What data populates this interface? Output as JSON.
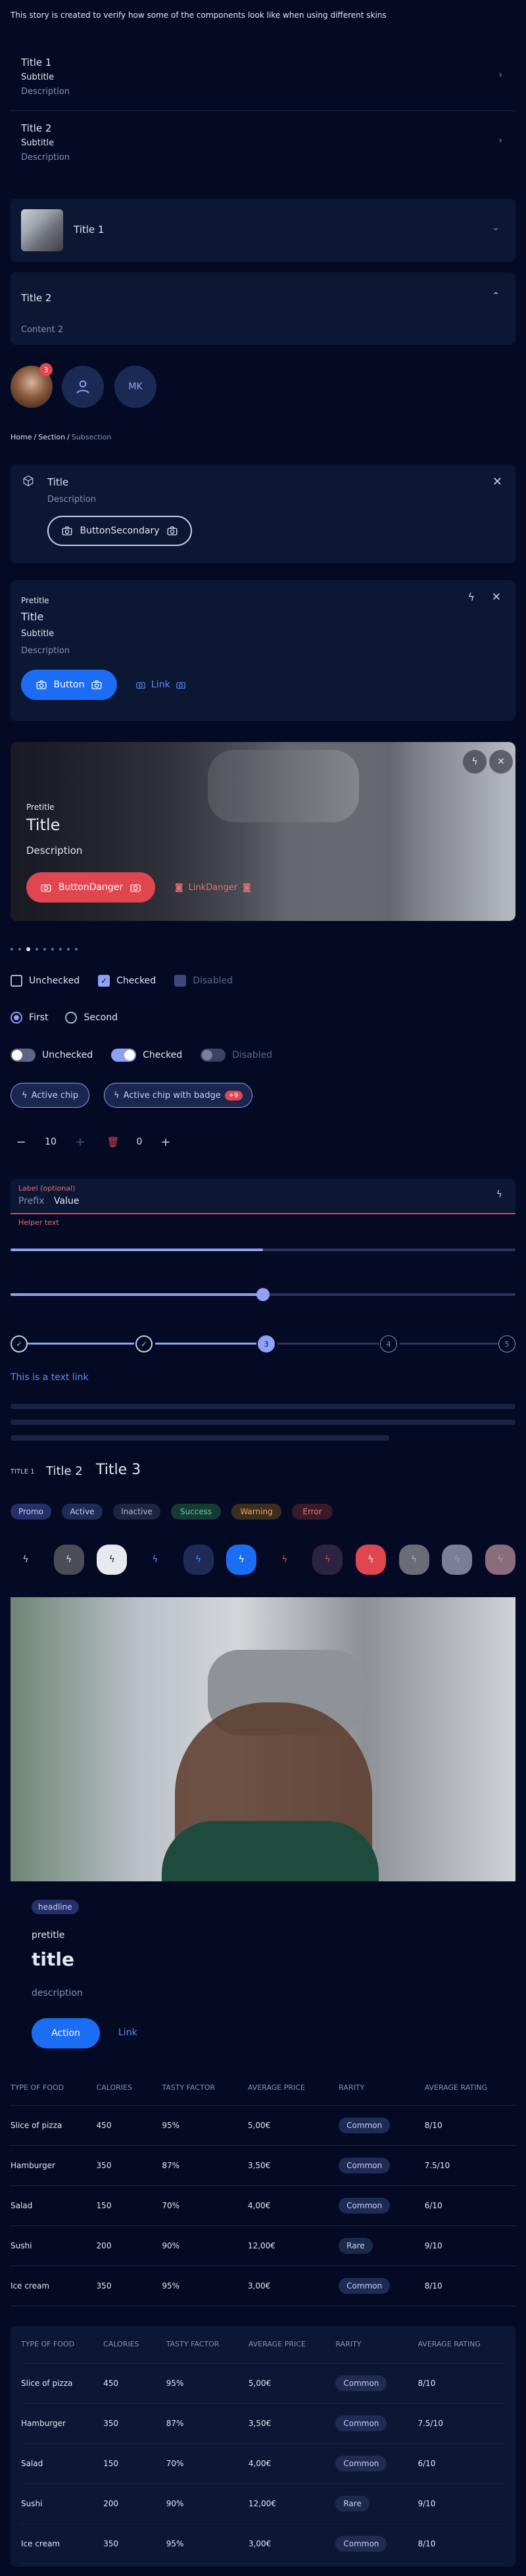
{
  "intro": "This story is created to verify how some of the components look like when using different skins",
  "list_items": [
    {
      "title": "Title 1",
      "subtitle": "Subtitle",
      "description": "Description"
    },
    {
      "title": "Title 2",
      "subtitle": "Subtitle",
      "description": "Description"
    }
  ],
  "accordion": {
    "item1_title": "Title 1",
    "item2_title": "Title 2",
    "item2_content": "Content 2"
  },
  "avatars": {
    "badge_count": "3",
    "initials": "MK"
  },
  "breadcrumb": {
    "home": "Home",
    "section": "Section",
    "subsection": "Subsection",
    "sep": "/"
  },
  "banner": {
    "title": "Title",
    "description": "Description",
    "button": "ButtonSecondary"
  },
  "card2": {
    "pretitle": "Pretitle",
    "title": "Title",
    "subtitle": "Subtitle",
    "description": "Description",
    "button": "Button",
    "link": "Link"
  },
  "hero": {
    "pretitle": "Pretitle",
    "title": "Title",
    "description": "Description",
    "button": "ButtonDanger",
    "link": "LinkDanger"
  },
  "checkboxes": [
    "Unchecked",
    "Checked",
    "Disabled"
  ],
  "radios": [
    "First",
    "Second"
  ],
  "switches": [
    "Unchecked",
    "Checked",
    "Disabled"
  ],
  "chips": {
    "chip1": "Active chip",
    "chip2": "Active chip with badge",
    "chip2_badge": "+9"
  },
  "steppers": {
    "value1": "10",
    "value2": "0"
  },
  "field": {
    "label": "Label (optional)",
    "prefix": "Prefix",
    "value": "Value",
    "helper": "Helper text"
  },
  "progress": {
    "bar_fraction": 0.5,
    "slider_fraction": 0.5
  },
  "steps": {
    "labels": [
      "",
      "",
      "3",
      "4",
      "5"
    ],
    "current": 3
  },
  "text_link": "This is a text link",
  "titles": {
    "t1": "TITLE 1",
    "t2": "Title 2",
    "t3": "Title 3"
  },
  "tags": [
    "Promo",
    "Active",
    "Inactive",
    "Success",
    "Warning",
    "Error"
  ],
  "media_card": {
    "headline": "headline",
    "pretitle": "pretitle",
    "title": "title",
    "description": "description",
    "action": "Action",
    "link": "Link"
  },
  "table": {
    "headers": [
      "TYPE OF FOOD",
      "CALORIES",
      "TASTY FACTOR",
      "AVERAGE PRICE",
      "RARITY",
      "AVERAGE RATING"
    ],
    "rows": [
      [
        "Slice of pizza",
        "450",
        "95%",
        "5,00€",
        "Common",
        "8/10"
      ],
      [
        "Hamburger",
        "350",
        "87%",
        "3,50€",
        "Common",
        "7.5/10"
      ],
      [
        "Salad",
        "150",
        "70%",
        "4,00€",
        "Common",
        "6/10"
      ],
      [
        "Sushi",
        "200",
        "90%",
        "12,00€",
        "Rare",
        "9/10"
      ],
      [
        "Ice cream",
        "350",
        "95%",
        "3,00€",
        "Common",
        "8/10"
      ]
    ]
  },
  "colors": {
    "background": "#050a24",
    "card": "#0c1734",
    "primary": "#1b6ef3",
    "danger": "#e0464f",
    "accent": "#8fa0f5"
  }
}
